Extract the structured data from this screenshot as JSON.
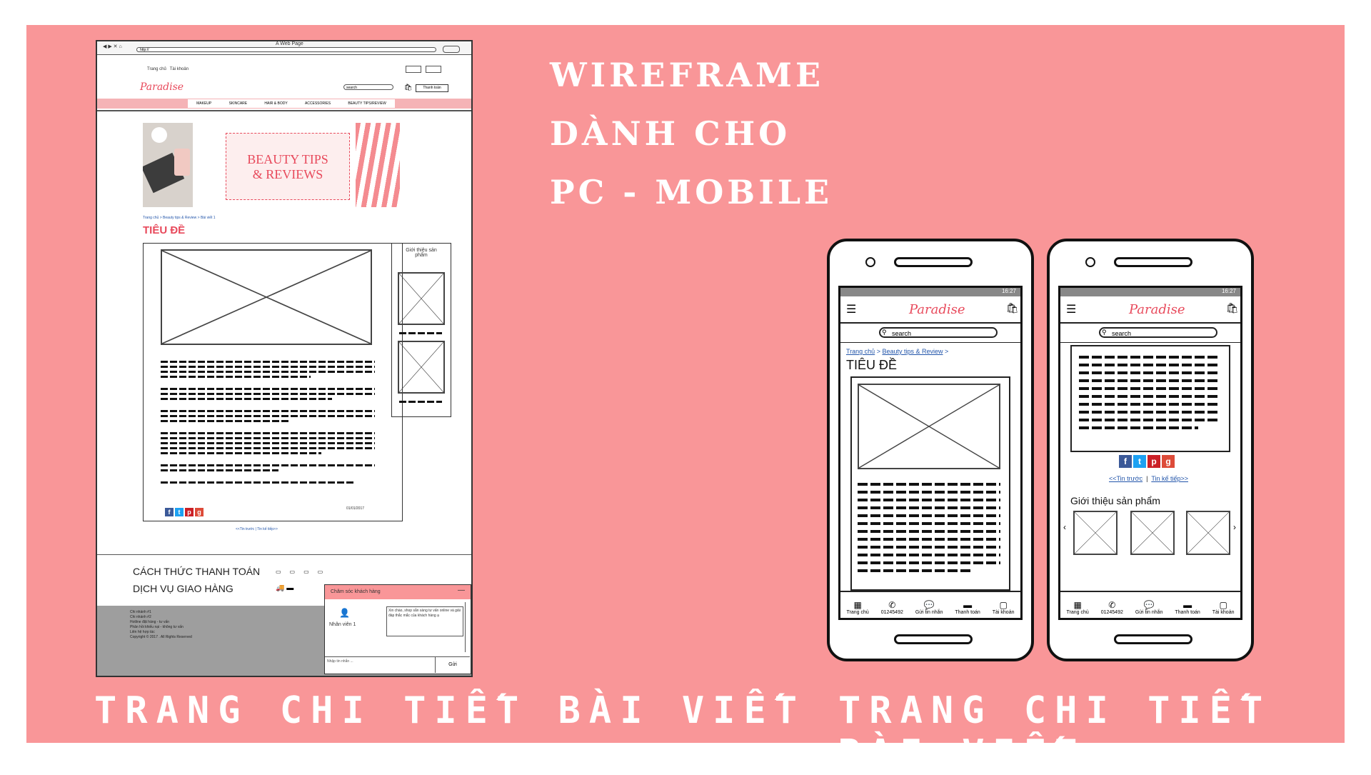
{
  "colors": {
    "board": "#f99698",
    "accent": "#e8495b",
    "pink_light": "#f5b3b6",
    "footer_gray": "#9e9e9e"
  },
  "heading": {
    "line1": "WIREFRAME",
    "line2": "DÀNH CHO",
    "line3": "PC - MOBILE"
  },
  "captions": {
    "left": "TRANG CHI TIẾT BÀI VIẾT",
    "right": "TRANG CHI TIẾT BÀI VIẾT"
  },
  "pc": {
    "window_title": "A Web Page",
    "url": "http://",
    "topnav": [
      "Trang chủ",
      "Tài khoản"
    ],
    "logo": "Paradise",
    "search_placeholder": "search",
    "checkout": "Thanh toán",
    "menu": [
      "MAKEUP",
      "SKINCARE",
      "HAIR & BODY",
      "ACCESSORIES",
      "BEAUTY TIPS/REVIEW"
    ],
    "banner_line1": "BEAUTY TIPS",
    "banner_line2": "& REVIEWS",
    "breadcrumb": "Trang chủ > Beauty tips & Review > Bài viết 1",
    "title": "TIÊU ĐỀ",
    "sidebar_title": "Giới thiệu sản phẩm",
    "date": "01/01/2017",
    "pager": "<<Tin trước | Tin kế tiếp>>",
    "payment": "CÁCH THỨC THANH TOÁN",
    "shipping": "DỊCH VỤ GIAO HÀNG",
    "footer_lines": [
      "Chi nhánh #1",
      "Chi nhánh #2",
      "Hotline đặt hàng - tư vấn",
      "Phản hồi khiếu nại - không tư vấn",
      "Liên hệ hợp tác",
      "Copyright © 2017 . All Rights Reserved"
    ],
    "chat_header": "Chăm sóc khách hàng",
    "chat_agent": "Nhân viên 1",
    "chat_message": "Xin chào, shop sẵn sàng tư vấn online và giải đáp thắc mắc của khách hàng ạ",
    "chat_input_placeholder": "Nhập tin nhắn ...",
    "chat_send": "Gửi"
  },
  "mobile": {
    "time": "16:27",
    "logo": "Paradise",
    "search_placeholder": "search",
    "breadcrumb_home": "Trang chủ",
    "breadcrumb_cat": "Beauty tips & Review",
    "title": "TIÊU ĐỀ",
    "prev": "<<Tin trước",
    "next": "Tin kế tiếp>>",
    "products_title": "Giới thiệu sản phẩm",
    "bottom_nav": [
      "Trang chủ",
      "01245492",
      "Gửi tin nhắn",
      "Thanh toán",
      "Tài khoản"
    ]
  }
}
